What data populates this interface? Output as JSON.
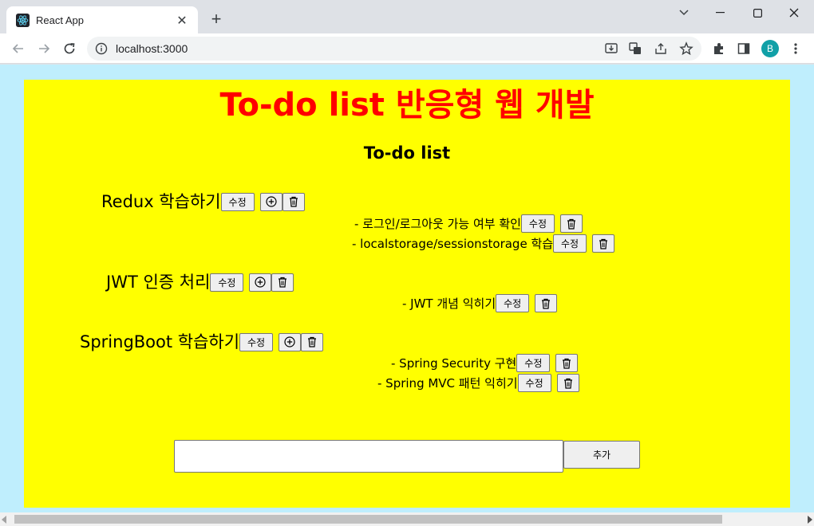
{
  "browser": {
    "tab_title": "React App",
    "url": "localhost:3000",
    "profile_initial": "B",
    "tab_close_symbol": "✕",
    "new_tab_symbol": "+"
  },
  "page": {
    "title": "To-do list 반응형 웹 개발",
    "list_title": "To-do list",
    "edit_label": "수정",
    "input_placeholder": "",
    "add_label": "추가"
  },
  "todos": [
    {
      "text": "Redux 학습하기",
      "subtasks": [
        "- 로그인/로그아웃 가능 여부 확인",
        "- localstorage/sessionstorage 학습"
      ]
    },
    {
      "text": "JWT 인증 처리",
      "subtasks": [
        "- JWT 개념 익히기"
      ]
    },
    {
      "text": "SpringBoot 학습하기",
      "subtasks": [
        "- Spring Security 구현",
        "- Spring MVC 패턴 익히기"
      ]
    }
  ],
  "icons": {
    "add_subtask": "plus-circle-icon",
    "delete": "trash-icon"
  },
  "colors": {
    "viewport_bg": "#bfeefd",
    "app_bg": "#ffff00",
    "title_color": "#ff0000"
  }
}
